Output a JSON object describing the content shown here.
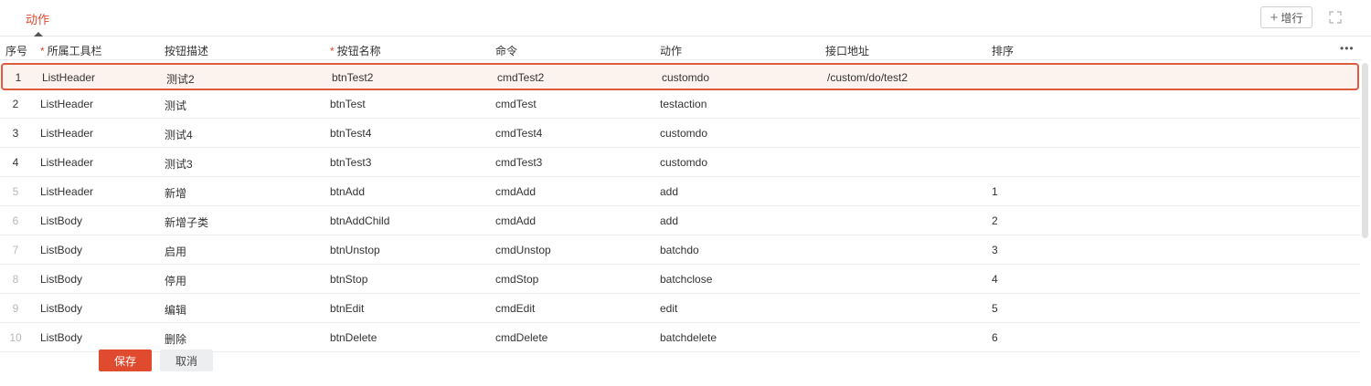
{
  "tabs": {
    "active_label": "动作"
  },
  "toolbar": {
    "add_row_label": "增行",
    "add_row_icon": "plus-icon",
    "fullscreen_icon": "fullscreen-icon",
    "more_icon": "more-icon"
  },
  "columns": [
    {
      "key": "index",
      "label": "序号",
      "required": false
    },
    {
      "key": "toolbar",
      "label": "所属工具栏",
      "required": true
    },
    {
      "key": "desc",
      "label": "按钮描述",
      "required": false
    },
    {
      "key": "name",
      "label": "按钮名称",
      "required": true
    },
    {
      "key": "command",
      "label": "命令",
      "required": false
    },
    {
      "key": "action",
      "label": "动作",
      "required": false
    },
    {
      "key": "url",
      "label": "接口地址",
      "required": false
    },
    {
      "key": "order",
      "label": "排序",
      "required": false
    }
  ],
  "rows": [
    {
      "index": "1",
      "toolbar": "ListHeader",
      "desc": "测试2",
      "name": "btnTest2",
      "command": "cmdTest2",
      "action": "customdo",
      "url": "/custom/do/test2",
      "order": "",
      "selected": true
    },
    {
      "index": "2",
      "toolbar": "ListHeader",
      "desc": "测试",
      "name": "btnTest",
      "command": "cmdTest",
      "action": "testaction",
      "url": "",
      "order": ""
    },
    {
      "index": "3",
      "toolbar": "ListHeader",
      "desc": "测试4",
      "name": "btnTest4",
      "command": "cmdTest4",
      "action": "customdo",
      "url": "",
      "order": ""
    },
    {
      "index": "4",
      "toolbar": "ListHeader",
      "desc": "测试3",
      "name": "btnTest3",
      "command": "cmdTest3",
      "action": "customdo",
      "url": "",
      "order": ""
    },
    {
      "index": "5",
      "toolbar": "ListHeader",
      "desc": "新增",
      "name": "btnAdd",
      "command": "cmdAdd",
      "action": "add",
      "url": "",
      "order": "1"
    },
    {
      "index": "6",
      "toolbar": "ListBody",
      "desc": "新增子类",
      "name": "btnAddChild",
      "command": "cmdAdd",
      "action": "add",
      "url": "",
      "order": "2"
    },
    {
      "index": "7",
      "toolbar": "ListBody",
      "desc": "启用",
      "name": "btnUnstop",
      "command": "cmdUnstop",
      "action": "batchdo",
      "url": "",
      "order": "3"
    },
    {
      "index": "8",
      "toolbar": "ListBody",
      "desc": "停用",
      "name": "btnStop",
      "command": "cmdStop",
      "action": "batchclose",
      "url": "",
      "order": "4"
    },
    {
      "index": "9",
      "toolbar": "ListBody",
      "desc": "编辑",
      "name": "btnEdit",
      "command": "cmdEdit",
      "action": "edit",
      "url": "",
      "order": "5"
    },
    {
      "index": "10",
      "toolbar": "ListBody",
      "desc": "删除",
      "name": "btnDelete",
      "command": "cmdDelete",
      "action": "batchdelete",
      "url": "",
      "order": "6"
    }
  ],
  "footer": {
    "save_label": "保存",
    "cancel_label": "取消"
  },
  "colors": {
    "accent": "#e04a2f",
    "selected_row_bg": "#fcf3ee",
    "selected_row_border": "#e05a3c"
  }
}
